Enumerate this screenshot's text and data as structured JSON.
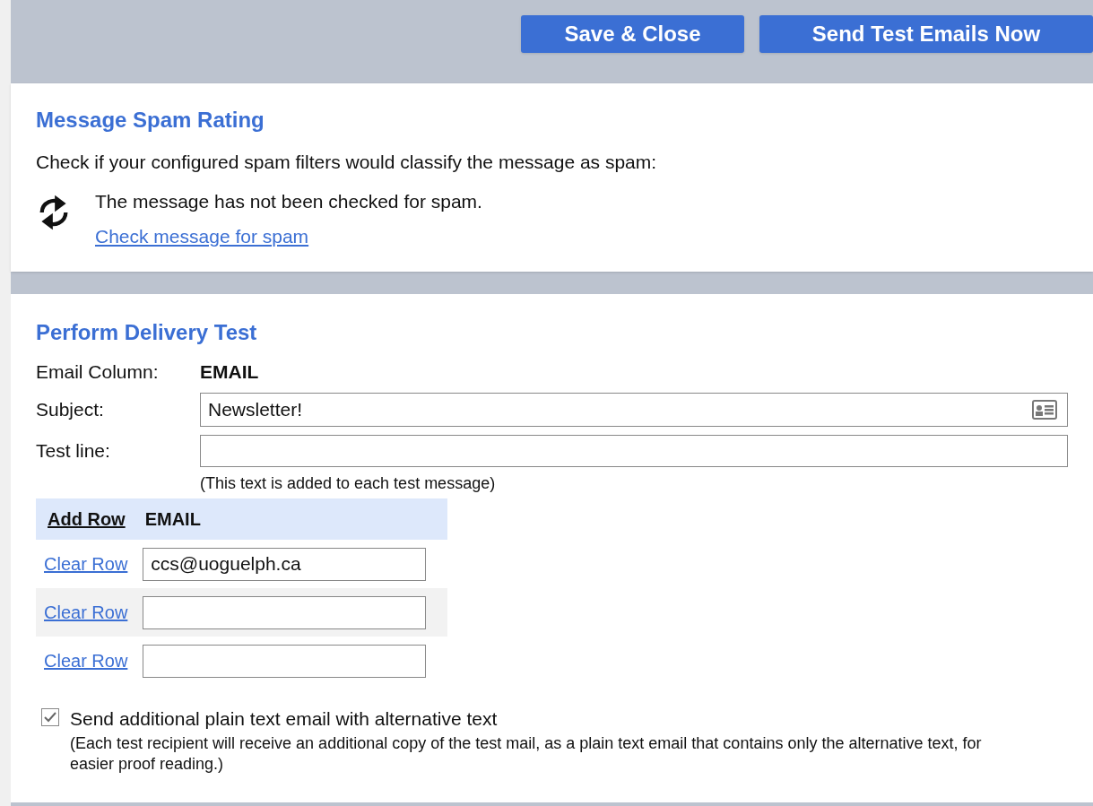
{
  "toolbar": {
    "buttons": [
      "Save & Close",
      "Send Test Emails Now"
    ]
  },
  "spam_panel": {
    "title": "Message Spam Rating",
    "description": "Check if your configured spam filters would classify the message as spam:",
    "status": "The message has not been checked for spam.",
    "link": "Check message for spam"
  },
  "delivery_panel": {
    "title": "Perform Delivery Test",
    "email_column": {
      "label": "Email Column:",
      "value": "EMAIL"
    },
    "subject": {
      "label": "Subject:",
      "value": "Newsletter!"
    },
    "test_line": {
      "label": "Test line:",
      "hint": "(This text is added to each test message)"
    },
    "table": {
      "add_row": "Add Row",
      "column": "EMAIL",
      "rows": [
        {
          "action": "Clear Row",
          "value": "ccs@uoguelph.ca"
        },
        {
          "action": "Clear Row"
        },
        {
          "action": "Clear Row"
        }
      ]
    },
    "plain_text_option": {
      "label": "Send additional plain text email with alternative text",
      "checked": true,
      "note": "(Each test recipient will receive an additional copy of the test mail, as a plain text email that contains only the alternative text, for easier proof reading.)"
    }
  }
}
